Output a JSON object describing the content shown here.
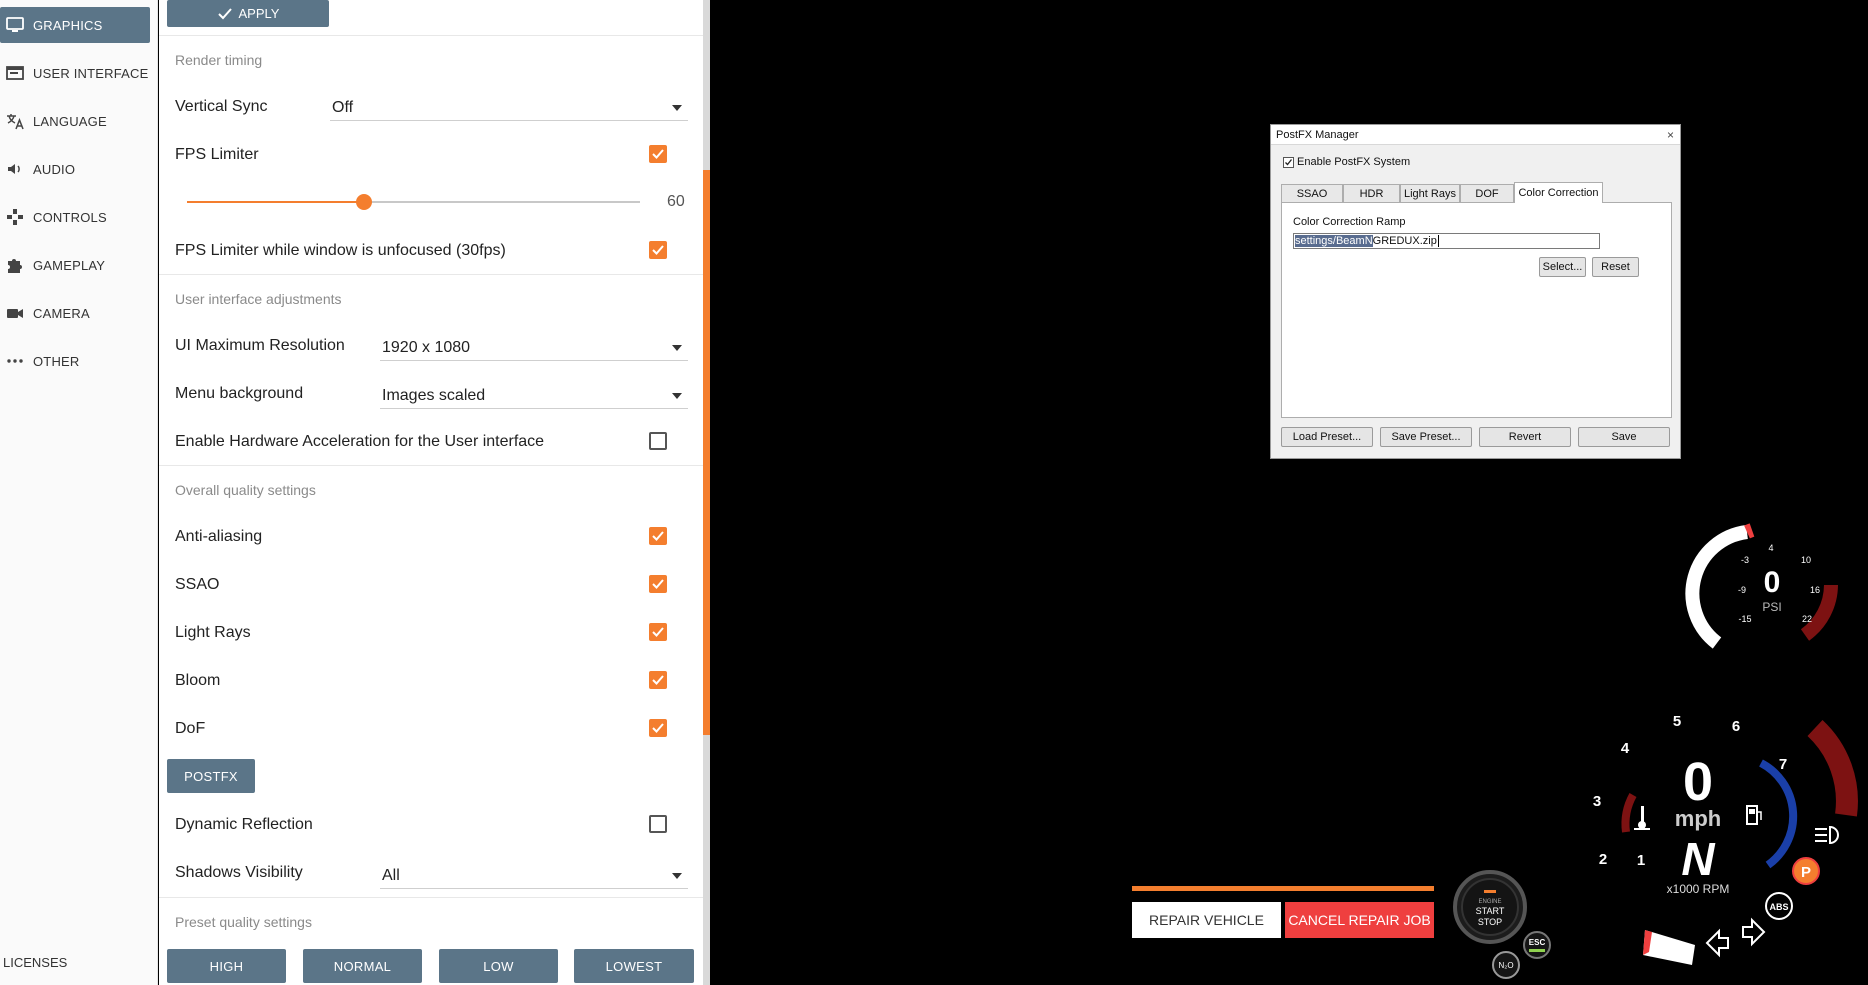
{
  "sidebar": {
    "items": [
      {
        "label": "GRAPHICS",
        "icon": "monitor-icon",
        "active": true
      },
      {
        "label": "USER INTERFACE",
        "icon": "window-icon"
      },
      {
        "label": "LANGUAGE",
        "icon": "translate-icon"
      },
      {
        "label": "AUDIO",
        "icon": "speaker-icon"
      },
      {
        "label": "CONTROLS",
        "icon": "gamepad-icon"
      },
      {
        "label": "GAMEPLAY",
        "icon": "puzzle-icon"
      },
      {
        "label": "CAMERA",
        "icon": "camera-icon"
      },
      {
        "label": "OTHER",
        "icon": "more-icon"
      }
    ],
    "footer": "LICENSES"
  },
  "settings": {
    "apply_label": "APPLY",
    "render_timing": {
      "heading": "Render timing",
      "vsync_label": "Vertical Sync",
      "vsync_value": "Off",
      "fps_limiter_label": "FPS Limiter",
      "fps_limiter_on": true,
      "fps_value": "60",
      "fps_slider_fraction": 0.39,
      "fps_unfocused_label": "FPS Limiter while window is unfocused (30fps)",
      "fps_unfocused_on": true
    },
    "ui_adjust": {
      "heading": "User interface adjustments",
      "max_res_label": "UI Maximum Resolution",
      "max_res_value": "1920 x 1080",
      "menu_bg_label": "Menu background",
      "menu_bg_value": "Images scaled",
      "hw_accel_label": "Enable Hardware Acceleration for the User interface",
      "hw_accel_on": false
    },
    "quality": {
      "heading": "Overall quality settings",
      "anti_aliasing": "Anti-aliasing",
      "ssao": "SSAO",
      "light_rays": "Light Rays",
      "bloom": "Bloom",
      "dof": "DoF",
      "postfx_btn": "POSTFX",
      "dyn_reflection": "Dynamic Reflection",
      "shadows_label": "Shadows Visibility",
      "shadows_value": "All"
    },
    "preset": {
      "heading": "Preset quality settings",
      "high": "HIGH",
      "normal": "NORMAL",
      "low": "LOW",
      "lowest": "LOWEST"
    }
  },
  "postfx": {
    "title": "PostFX Manager",
    "close": "×",
    "enable_label": "Enable PostFX System",
    "enabled": true,
    "tabs": [
      "SSAO",
      "HDR",
      "Light Rays",
      "DOF",
      "Color Correction"
    ],
    "active_tab": "Color Correction",
    "ramp_label": "Color Correction Ramp",
    "ramp_selected": "settings/BeamN",
    "ramp_rest": "GREDUX.zip",
    "select_btn": "Select...",
    "reset_btn": "Reset",
    "load_preset": "Load Preset...",
    "save_preset": "Save Preset...",
    "revert": "Revert",
    "save": "Save"
  },
  "repair": {
    "repair_label": "REPAIR VEHICLE",
    "cancel_label": "CANCEL REPAIR JOB"
  },
  "hud": {
    "boost": {
      "value": "0",
      "unit": "PSI",
      "ticks": [
        "4",
        "-3",
        "10",
        "-9",
        "16",
        "-15",
        "22"
      ]
    },
    "speed": {
      "value": "0",
      "unit": "mph",
      "gear": "N",
      "rpm_unit": "x1000 RPM"
    },
    "rpm_ticks": [
      "1",
      "2",
      "3",
      "4",
      "5",
      "6",
      "7"
    ],
    "start_stop": {
      "line1": "ENGINE",
      "line2": "START",
      "line3": "STOP"
    },
    "esc": "ESC",
    "n2o": "N₂O",
    "abs": "ABS",
    "parking": "P",
    "colors": {
      "accent": "#f47e2e",
      "alert": "#ef3f3f",
      "gauge_red": "#7d1212",
      "gauge_blue": "#1a3fa8"
    }
  }
}
